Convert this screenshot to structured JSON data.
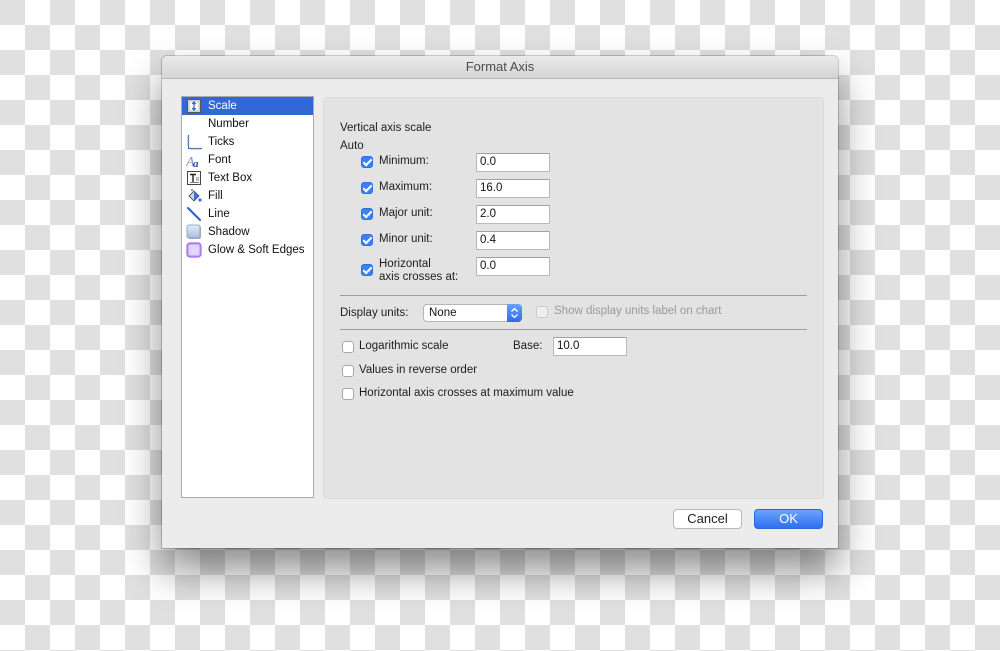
{
  "dialog": {
    "title": "Format Axis"
  },
  "sidebar": {
    "items": [
      {
        "label": "Scale",
        "icon": "scale-icon",
        "selected": true
      },
      {
        "label": "Number",
        "icon": "",
        "selected": false
      },
      {
        "label": "Ticks",
        "icon": "ticks-icon",
        "selected": false
      },
      {
        "label": "Font",
        "icon": "font-icon",
        "selected": false
      },
      {
        "label": "Text Box",
        "icon": "text-box-icon",
        "selected": false
      },
      {
        "label": "Fill",
        "icon": "fill-bucket-icon",
        "selected": false
      },
      {
        "label": "Line",
        "icon": "line-icon",
        "selected": false
      },
      {
        "label": "Shadow",
        "icon": "shadow-icon",
        "selected": false
      },
      {
        "label": "Glow & Soft Edges",
        "icon": "glow-icon",
        "selected": false
      }
    ]
  },
  "scale": {
    "section_title": "Vertical axis scale",
    "auto_label": "Auto",
    "fields": [
      {
        "label": "Minimum:",
        "value": "0.0",
        "auto_checked": true
      },
      {
        "label": "Maximum:",
        "value": "16.0",
        "auto_checked": true
      },
      {
        "label": "Major unit:",
        "value": "2.0",
        "auto_checked": true
      },
      {
        "label": "Minor unit:",
        "value": "0.4",
        "auto_checked": true
      },
      {
        "label_line1": "Horizontal",
        "label_line2": "axis crosses at:",
        "value": "0.0",
        "auto_checked": true
      }
    ],
    "display_units": {
      "label": "Display units:",
      "selected": "None",
      "show_label_text": "Show display units label on chart",
      "show_label_checked": false,
      "show_label_enabled": false
    },
    "options": {
      "logarithmic": {
        "label": "Logarithmic scale",
        "checked": false
      },
      "base_label": "Base:",
      "base_value": "10.0",
      "reverse": {
        "label": "Values in reverse order",
        "checked": false
      },
      "crosses_max": {
        "label": "Horizontal axis crosses at maximum value",
        "checked": false
      }
    }
  },
  "buttons": {
    "cancel": "Cancel",
    "ok": "OK"
  },
  "colors": {
    "accent": "#3467d6",
    "checkbox": "#3d80f2",
    "ok_button": "#3a7cf2"
  }
}
